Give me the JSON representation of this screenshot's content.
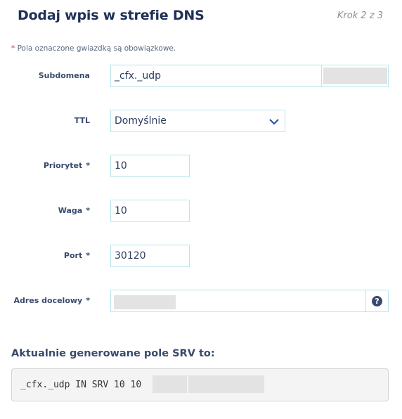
{
  "header": {
    "title": "Dodaj wpis w strefie DNS",
    "step": "Krok 2 z 3"
  },
  "note": {
    "star": "*",
    "text": " Pola oznaczone gwiazdką są obowiązkowe."
  },
  "form": {
    "subdomain": {
      "label": "Subdomena",
      "value": "_cfx._udp"
    },
    "ttl": {
      "label": "TTL",
      "value": "Domyślnie"
    },
    "priority": {
      "label": "Priorytet",
      "required_mark": "*",
      "value": "10"
    },
    "weight": {
      "label": "Waga",
      "required_mark": "*",
      "value": "10"
    },
    "port": {
      "label": "Port",
      "required_mark": "*",
      "value": "30120"
    },
    "target": {
      "label": "Adres docelowy",
      "required_mark": "*",
      "value": ""
    },
    "help_icon": "?"
  },
  "srv": {
    "title": "Aktualnie generowane pole SRV to:",
    "record": "_cfx._udp IN SRV 10 10"
  },
  "icons": {
    "chevron": "chevron-down-icon",
    "help": "question-circle-icon"
  },
  "colors": {
    "border": "#b6e6ee",
    "title": "#1f3058",
    "required": "#d8262d"
  }
}
